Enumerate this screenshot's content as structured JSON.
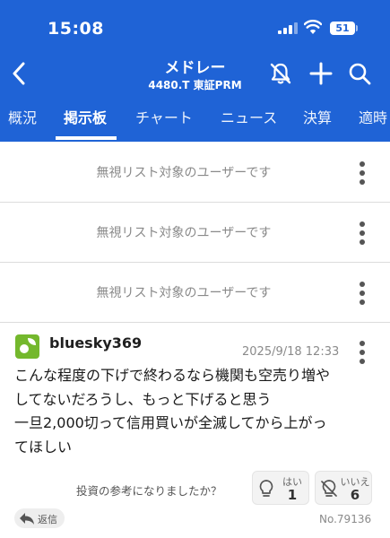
{
  "status_bar": {
    "time": "15:08",
    "battery": "51"
  },
  "header": {
    "title": "メドレー",
    "subtitle": "4480.T 東証PRM",
    "accent_color": "#1f63d6",
    "icons": [
      "back-chevron-icon",
      "bell-off-icon",
      "plus-icon",
      "search-icon"
    ]
  },
  "tabs": [
    {
      "label": "概況"
    },
    {
      "label": "掲示板",
      "active": true
    },
    {
      "label": "チャート"
    },
    {
      "label": "ニュース"
    },
    {
      "label": "決算"
    },
    {
      "label": "適時"
    }
  ],
  "ignored_rows": [
    {
      "message": "無視リスト対象のユーザーです"
    },
    {
      "message": "無視リスト対象のユーザーです"
    },
    {
      "message": "無視リスト対象のユーザーです"
    }
  ],
  "post": {
    "username": "bluesky369",
    "timestamp": "2025/9/18 12:33",
    "lines": [
      "こんな程度の下げで終わるなら機関も空売り増や",
      "してないだろうし、もっと下げると思う",
      "一旦2,000切って信用買いが全滅してから上がっ",
      "てほしい"
    ],
    "vote_question": "投資の参考になりましたか？",
    "yes": {
      "label": "はい",
      "count": "1"
    },
    "no": {
      "label": "いいえ",
      "count": "6"
    },
    "reply_label": "返信",
    "post_number": "No.79136"
  }
}
